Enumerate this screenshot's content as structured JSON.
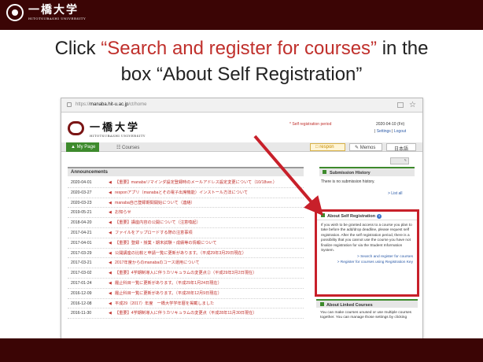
{
  "slide": {
    "university_name_jp": "一橋大学",
    "university_name_en": "HITOTSUBASHI UNIVERSITY",
    "title_prefix": "Click ",
    "title_highlight": "“Search and register for courses”",
    "title_middle": " in the",
    "title_line2": "box “About Self Registration”"
  },
  "browser": {
    "url_prefix": "https://",
    "url_host": "manaba.hit-u.ac.jp",
    "url_path": "/ct/home",
    "bookmark_icon": "star-icon"
  },
  "manaba": {
    "logo_jp": "一橋大学",
    "logo_en": "HITOTSUBASHI UNIVERSITY",
    "registration_period_label": "* Self registration period",
    "date": "2020-04-10 (Fri)",
    "settings_label": "Settings",
    "logout_label": "Logout",
    "separator": "|",
    "nav": {
      "mypage": "My Page",
      "courses": "Courses",
      "respon": "respon",
      "memos": "Memos",
      "language": "日本語"
    },
    "announcements_title": "Announcements",
    "announcements": [
      {
        "date": "2020-04-01",
        "text": "【重要】manabaリマインダ設定登録時のメールアドレス設定変更について（10/18ver.）"
      },
      {
        "date": "2020-03-27",
        "text": "responアプリ（manabaとその電子出席機能）インストール方法について"
      },
      {
        "date": "2020-03-23",
        "text": "manaba自己登録期間開始について（連絡）"
      },
      {
        "date": "2019-05-21",
        "text": "お知らせ"
      },
      {
        "date": "2018-04-20",
        "text": "【重要】講座内容の公開について（注意喚起）"
      },
      {
        "date": "2017-04-21",
        "text": "ファイルをアップロードする際の注意事項"
      },
      {
        "date": "2017-04-01",
        "text": "【重要】登録・授業・期末試験・成績等の情報について"
      },
      {
        "date": "2017-03-29",
        "text": "公開講座の比較と申請一覧に更新があります。（平成29年3月29日現在）"
      },
      {
        "date": "2017-03-21",
        "text": "2017年度からのmanabaのコース運用について"
      },
      {
        "date": "2017-03-02",
        "text": "【重要】4学期制導入に伴うカリキュラムの変更点②（平成29年3月2日現在）"
      },
      {
        "date": "2017-01-24",
        "text": "履止科目一覧に更新があります。（平成29年1月24日現在）"
      },
      {
        "date": "2016-12-09",
        "text": "履止科目一覧に更新があります。（平成28年12月9日現在）"
      },
      {
        "date": "2016-12-08",
        "text": "平成29（2017）年度　一橋大学学年暦を掲載しました"
      },
      {
        "date": "2016-11-30",
        "text": "【重要】4学期制導入に伴うカリキュラムの変更点（平成28年11月30日現在）"
      }
    ],
    "submission_title": "Submission History",
    "submission_text": "There is no submission history.",
    "submission_link": "> List all",
    "self_reg_title": "About Self Registration",
    "self_reg_body": "If you wish to be granted access to a course you plan to take before the add/drop deadline, please request self registration. After the self registration period, there is a possibility that you cannot use the course you have not finalize registration for via the Student Information System.",
    "self_reg_link1": "> Search and register for courses",
    "self_reg_link2": "> Register for courses using Registration Key",
    "linked_title": "About Linked Courses",
    "linked_body": "You can make courses unused or use multiple courses together. You can manage those settings by clicking"
  },
  "colors": {
    "slide_bar": "#3b0505",
    "highlight": "#c0302c",
    "box_border": "#c8202a",
    "manaba_green": "#3d8a2c",
    "link": "#2b5aa7"
  }
}
